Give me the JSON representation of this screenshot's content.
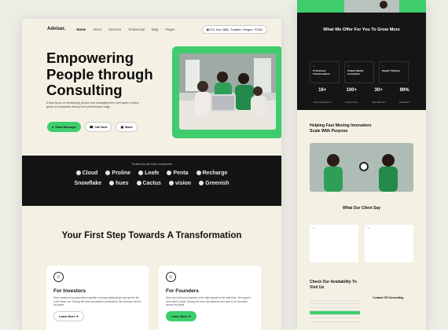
{
  "nav": {
    "logo": "Adviser.",
    "links": [
      "Home",
      "About",
      "Services",
      "Testimonial",
      "Blog",
      "Page"
    ],
    "active": "Home",
    "address": "P.O. Box 2882, Tualatin, Oregon, 97062"
  },
  "hero": {
    "title": "Empowering People through Consulting",
    "subtitle": "A dual focus on developing people and managing them well gives a select group of companies strong form performance edge.",
    "buttons": {
      "send": "Send Message",
      "call": "Call Now",
      "book": "Book"
    }
  },
  "trusted": {
    "title": "Trusted by the best companies",
    "row1": [
      "Cloud",
      "Proline",
      "Leafe",
      "Penta",
      "Recharge"
    ],
    "row2": [
      "Snowflake",
      "hues",
      "Cactus",
      "vision",
      "Greenish"
    ]
  },
  "steps": {
    "title": "Your First Step Towards A Transformation",
    "cards": [
      {
        "title": "For Investors",
        "text": "Find investment opportunities available in strong relationships and get the list to the fresh one, Seeing the best consultations dedicate to the investors across the globe.",
        "button": "Learn More"
      },
      {
        "title": "For Founders",
        "text": "Grow and sell your business to the right people at the right time. Get support from start to close. Seeing the best consultations and plan to the founders across the globe.",
        "button": "Learn More"
      }
    ]
  },
  "right": {
    "offer_title": "What We Offer For You To Grow More",
    "services": [
      "IT Business Transformation",
      "Subject Matter Consultant",
      "Digital Thinking"
    ],
    "stats": [
      {
        "value": "16+",
        "label": "Years of Experience"
      },
      {
        "value": "100+",
        "label": "Projects Done"
      },
      {
        "value": "30+",
        "label": "Team Members"
      },
      {
        "value": "99%",
        "label": "Satisfaction"
      }
    ],
    "help_title": "Helping Fast Moving Innovators Scale With Purpose",
    "client_title": "What Our Client Say",
    "availability_title": "Check Our Availability To Visit Us",
    "contact_title": "Contact CR Consulting"
  }
}
